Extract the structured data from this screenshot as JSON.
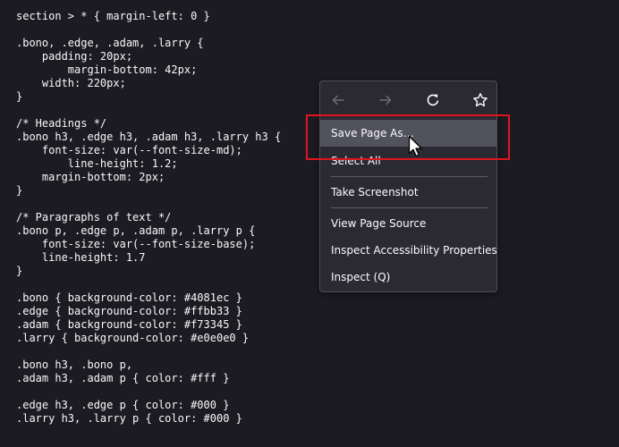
{
  "code_lines": [
    "section > * { margin-left: 0 }",
    "",
    ".bono, .edge, .adam, .larry {",
    "    padding: 20px;",
    "        margin-bottom: 42px;",
    "    width: 220px;",
    "}",
    "",
    "/* Headings */",
    ".bono h3, .edge h3, .adam h3, .larry h3 {",
    "    font-size: var(--font-size-md);",
    "        line-height: 1.2;",
    "    margin-bottom: 2px;",
    "}",
    "",
    "/* Paragraphs of text */",
    ".bono p, .edge p, .adam p, .larry p {",
    "    font-size: var(--font-size-base);",
    "    line-height: 1.7",
    "}",
    "",
    ".bono { background-color: #4081ec }",
    ".edge { background-color: #ffbb33 }",
    ".adam { background-color: #f73345 }",
    ".larry { background-color: #e0e0e0 }",
    "",
    ".bono h3, .bono p,",
    ".adam h3, .adam p { color: #fff }",
    "",
    ".edge h3, .edge p { color: #000 }",
    ".larry h3, .larry p { color: #000 }"
  ],
  "context_menu": {
    "nav": {
      "back_icon": "back-arrow-icon",
      "forward_icon": "forward-arrow-icon",
      "reload_icon": "reload-icon",
      "bookmark_icon": "star-icon"
    },
    "items": [
      {
        "label": "Save Page As…",
        "hovered": true
      },
      {
        "label": "Select All"
      },
      {
        "label": "Take Screenshot"
      },
      {
        "label": "View Page Source"
      },
      {
        "label": "Inspect Accessibility Properties"
      },
      {
        "label": "Inspect (Q)"
      }
    ]
  },
  "colors": {
    "background": "#1c1b22",
    "menu_background": "#2b2a33",
    "menu_hover": "#52525e",
    "highlight_border": "#e0141e",
    "disabled_icon": "#6c6c75"
  }
}
